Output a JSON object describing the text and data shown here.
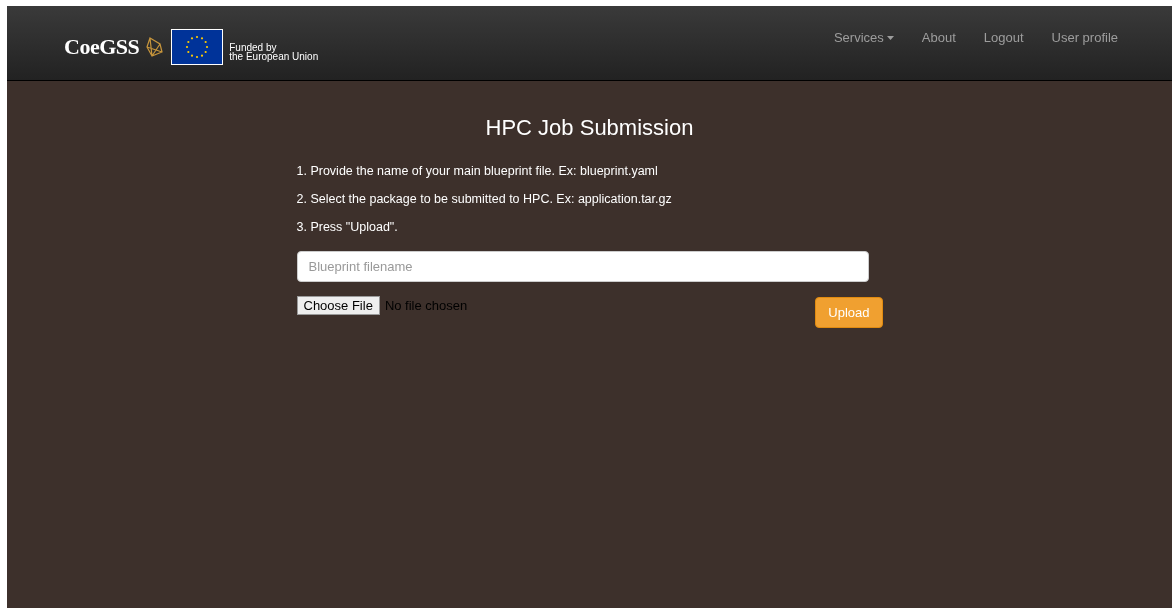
{
  "brand": {
    "name": "CoeGSS",
    "funding": [
      "Funded by",
      "the European Union"
    ]
  },
  "nav": [
    {
      "label": "Services",
      "kind": "dropdown"
    },
    {
      "label": "About",
      "kind": "link"
    },
    {
      "label": "Logout",
      "kind": "link"
    },
    {
      "label": "User profile",
      "kind": "link"
    }
  ],
  "title": "HPC Job Submission",
  "steps": [
    "1. Provide the name of your main blueprint file. Ex: blueprint.yaml",
    "2. Select the package to be submitted to HPC. Ex: application.tar.gz",
    "3. Press \"Upload\"."
  ],
  "blueprint_field": {
    "placeholder": "Blueprint filename"
  },
  "file_input": {
    "button": "Choose File",
    "status": "No file chosen"
  },
  "upload_button": "Upload"
}
